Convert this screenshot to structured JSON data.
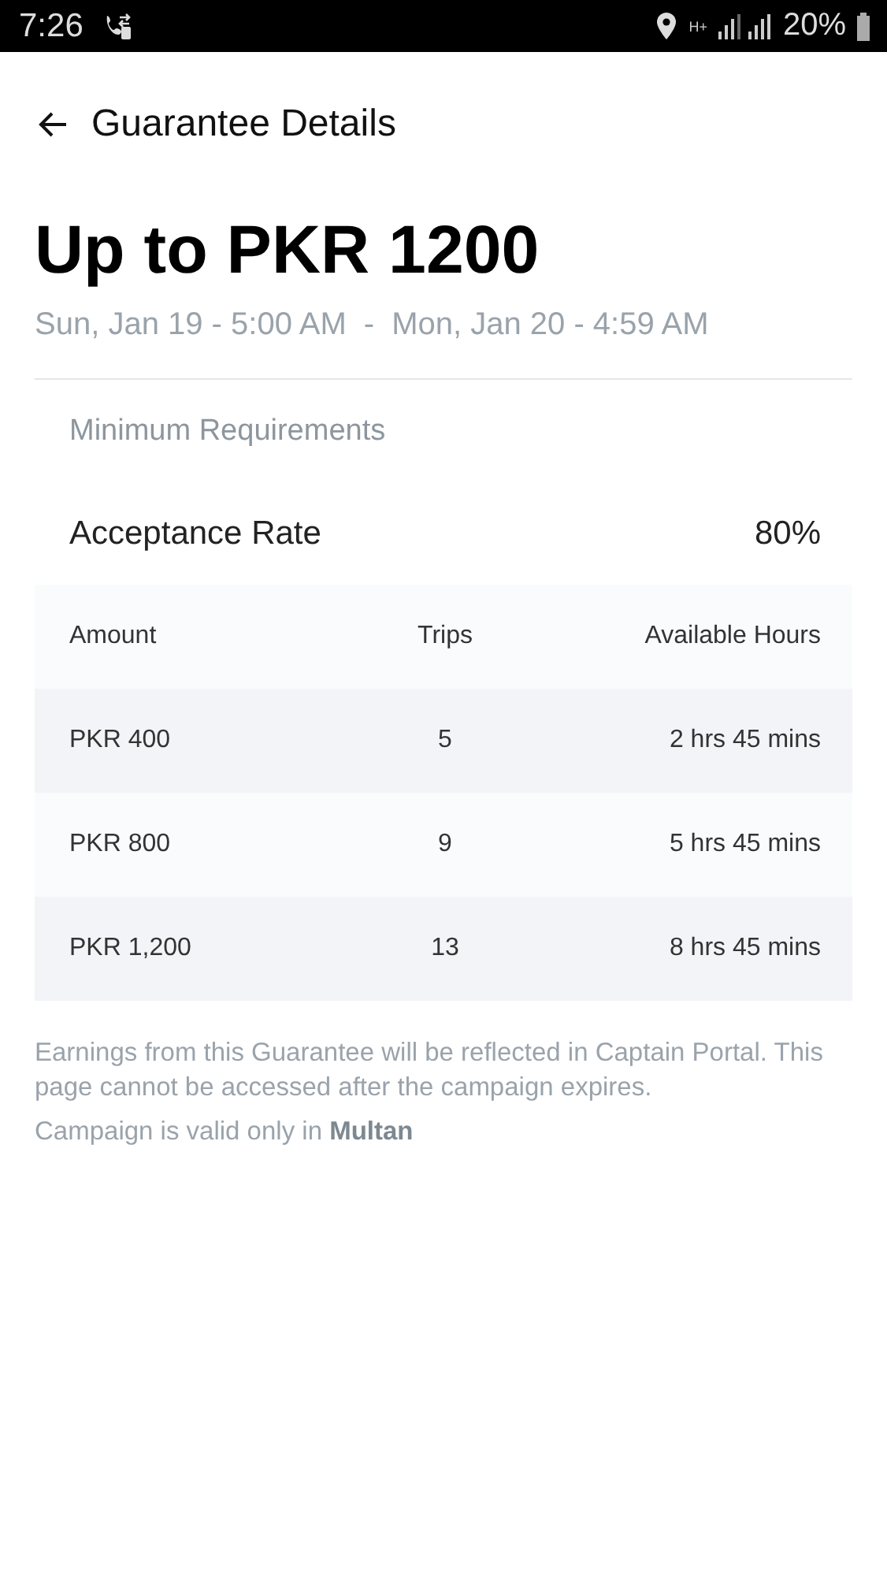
{
  "status_bar": {
    "time": "7:26",
    "network": "H+",
    "battery": "20%"
  },
  "header": {
    "title": "Guarantee Details"
  },
  "headline": "Up to PKR 1200",
  "period": {
    "start": "Sun, Jan 19 - 5:00 AM",
    "separator": "-",
    "end": "Mon, Jan 20 - 4:59 AM"
  },
  "requirements": {
    "title": "Minimum Requirements",
    "label": "Acceptance Rate",
    "value": "80%"
  },
  "table": {
    "columns": [
      "Amount",
      "Trips",
      "Available Hours"
    ],
    "rows": [
      [
        "PKR 400",
        "5",
        "2 hrs 45 mins"
      ],
      [
        "PKR 800",
        "9",
        "5 hrs 45 mins"
      ],
      [
        "PKR 1,200",
        "13",
        "8 hrs 45 mins"
      ]
    ]
  },
  "note": "Earnings from this Guarantee will be reflected in Captain Portal. This page cannot be accessed after the campaign expires.",
  "validity": "Campaign is valid only in **Multan**"
}
